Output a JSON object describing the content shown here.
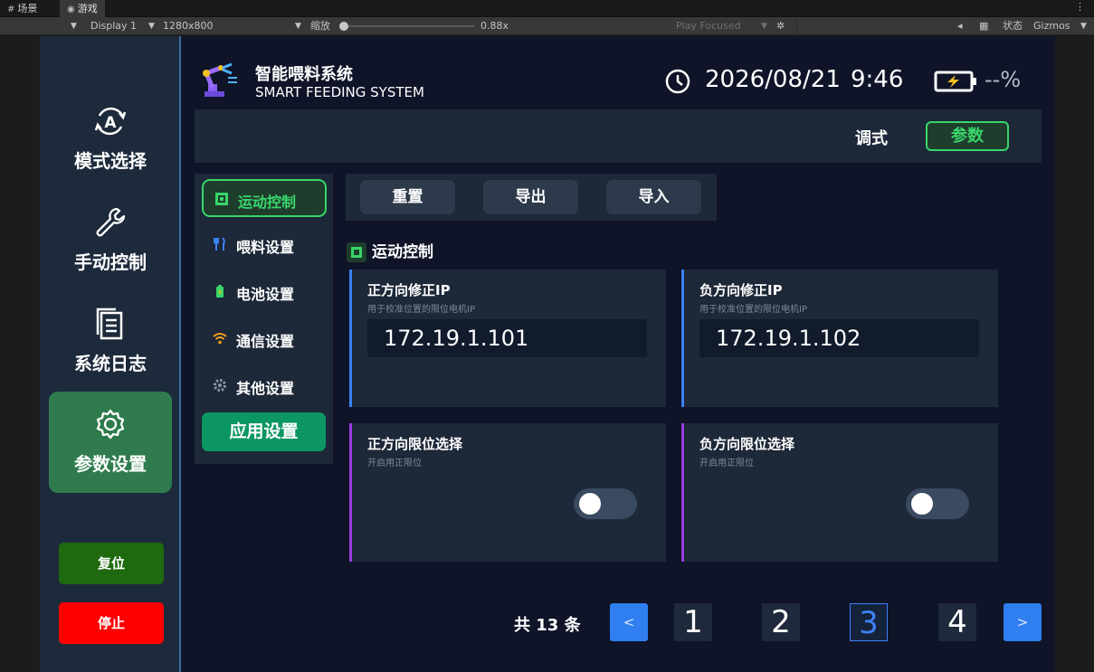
{
  "editor": {
    "tabs": [
      "场景",
      "游戏"
    ],
    "display": "Display 1",
    "resolution": "1280x800",
    "zoom_label": "缩放",
    "zoom_value": "0.88x",
    "play_mode": "Play Focused",
    "status_label": "状态",
    "gizmos": "Gizmos"
  },
  "app": {
    "title_zh": "智能喂料系统",
    "title_en": "SMART FEEDING SYSTEM",
    "date": "2026/08/21",
    "time": "9:46",
    "battery": "--%"
  },
  "sidebar": {
    "items": [
      {
        "label": "模式选择",
        "icon": "auto-mode-icon"
      },
      {
        "label": "手动控制",
        "icon": "wrench-icon"
      },
      {
        "label": "系统日志",
        "icon": "document-icon"
      },
      {
        "label": "参数设置",
        "icon": "gear-icon",
        "active": true
      }
    ],
    "reset": "复位",
    "stop": "停止"
  },
  "modes": {
    "debug": "调式",
    "param": "参数"
  },
  "subnav": {
    "items": [
      {
        "label": "运动控制",
        "icon": "chip-icon",
        "active": true
      },
      {
        "label": "喂料设置",
        "icon": "utensils-icon"
      },
      {
        "label": "电池设置",
        "icon": "battery-icon"
      },
      {
        "label": "通信设置",
        "icon": "wifi-icon"
      },
      {
        "label": "其他设置",
        "icon": "gear-icon"
      }
    ],
    "apply": "应用设置"
  },
  "actions": {
    "reset": "重置",
    "export": "导出",
    "import": "导入"
  },
  "section": {
    "title": "运动控制"
  },
  "cards": [
    {
      "title": "正方向修正IP",
      "subtitle": "用于校准位置的限位电机IP",
      "value": "172.19.1.101"
    },
    {
      "title": "负方向修正IP",
      "subtitle": "用于校准位置的限位电机IP",
      "value": "172.19.1.102"
    },
    {
      "title": "正方向限位选择",
      "subtitle": "开启用正限位",
      "enabled": false
    },
    {
      "title": "负方向限位选择",
      "subtitle": "开启用正限位",
      "enabled": false
    }
  ],
  "pagination": {
    "total": "共 13 条",
    "prev": "<",
    "next": ">",
    "pages": [
      "1",
      "2",
      "3",
      "4"
    ],
    "current": "3"
  },
  "colors": {
    "accent_green": "#38d66b",
    "accent_blue": "#3b82f6",
    "accent_purple": "#9b3ce0",
    "stop_red": "#ff0000",
    "reset_green": "#1f6a0f",
    "apply_green": "#0c9663"
  }
}
